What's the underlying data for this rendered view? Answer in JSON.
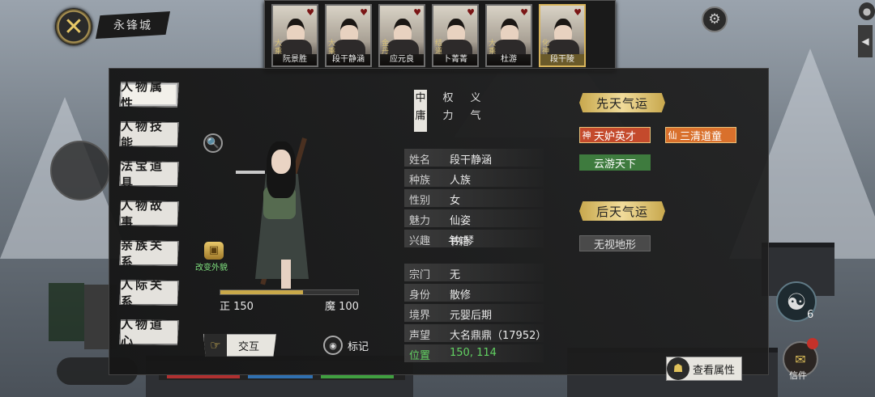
{
  "location": "永锋城",
  "party": [
    {
      "name": "阮景胜",
      "tag": "大乘"
    },
    {
      "name": "段干静涵",
      "tag": "大乘"
    },
    {
      "name": "应元良",
      "tag": "金丹"
    },
    {
      "name": "卜菁菁",
      "tag": "结道"
    },
    {
      "name": "杜游",
      "tag": "大乘"
    },
    {
      "name": "段干陵",
      "tag": "化神",
      "selected": true
    }
  ],
  "tabs": [
    "人物属性",
    "人物技能",
    "法宝道具",
    "人物故事",
    "亲族关系",
    "人际关系",
    "人物道心"
  ],
  "active_tab": "人物属性",
  "change_look": "改变外貌",
  "alignment": {
    "zheng_label": "正 150",
    "mo_label": "魔 100",
    "fill_fraction": 0.6
  },
  "actions": {
    "interact": "交互",
    "mark": "标记"
  },
  "personality": [
    {
      "text": [
        "中",
        "庸"
      ],
      "active": true
    },
    {
      "text": [
        "权",
        "力"
      ],
      "active": false
    },
    {
      "text": [
        "义",
        "气"
      ],
      "active": false
    }
  ],
  "info_group1": [
    {
      "key": "姓名",
      "value": "段干静涵"
    },
    {
      "key": "种族",
      "value": "人族"
    },
    {
      "key": "性别",
      "value": "女"
    },
    {
      "key": "魅力",
      "value": "仙姿"
    },
    {
      "key": "兴趣",
      "value": "钟  琴"
    }
  ],
  "hobby_extra": "书籍",
  "info_group2": [
    {
      "key": "宗门",
      "value": "无"
    },
    {
      "key": "身份",
      "value": "散修"
    },
    {
      "key": "境界",
      "value": "元婴后期"
    },
    {
      "key": "声望",
      "value": "大名鼎鼎（17952）"
    },
    {
      "key": "位置",
      "value": "150, 114",
      "green": true
    }
  ],
  "innate_fortune": {
    "title": "先天气运",
    "traits": [
      {
        "badge": "神",
        "label": "天妒英才",
        "color": "#c44a2c"
      },
      {
        "badge": "仙",
        "label": "三清道童",
        "color": "#d9702c"
      },
      {
        "badge": "",
        "label": "云游天下",
        "color": "#3e7b3e"
      }
    ]
  },
  "acquired_fortune": {
    "title": "后天气运",
    "traits": [
      {
        "label": "无视地形"
      }
    ]
  },
  "view_attributes": "查看属性",
  "taiji_count": "6",
  "mail_label": "信件",
  "icons": {
    "back": "crossed-swords-icon",
    "settings": "gear-icon",
    "zoom": "magnifier-icon",
    "change_look": "chest-icon",
    "interact": "hand-icon",
    "mark": "eye-icon",
    "view_attr": "seated-figure-icon",
    "taiji": "taiji-icon",
    "mail": "scroll-icon"
  }
}
